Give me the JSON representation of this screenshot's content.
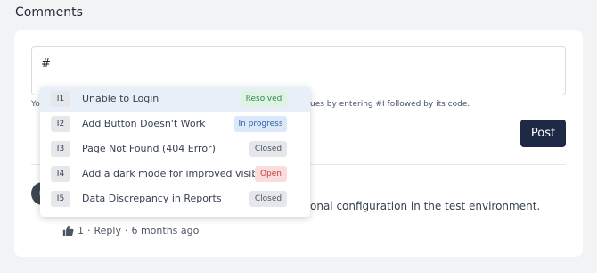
{
  "section_title": "Comments",
  "composer": {
    "value": "#",
    "hint_left": "Yo",
    "hint": "ues by entering #I followed by its code.",
    "post_label": "Post"
  },
  "comment": {
    "text_visible": "onal configuration in the test environment.",
    "likes": "1",
    "separator": "·",
    "reply_label": "Reply",
    "time": "6 months ago"
  },
  "dropdown": {
    "items": [
      {
        "code": "I1",
        "label": "Unable to Login",
        "status": "Resolved",
        "status_color": "#2f8a4f",
        "status_bg": "#dff3e4",
        "active": true
      },
      {
        "code": "I2",
        "label": "Add Button Doesn't Work",
        "status": "In progress",
        "status_color": "#2d5fa8",
        "status_bg": "#dbe8f8",
        "active": false
      },
      {
        "code": "I3",
        "label": "Page Not Found (404 Error)",
        "status": "Closed",
        "status_color": "#4b5563",
        "status_bg": "#e5e7eb",
        "active": false
      },
      {
        "code": "I4",
        "label": "Add a dark mode for improved visibility.",
        "status": "Open",
        "status_color": "#c2413b",
        "status_bg": "#fbdcdc",
        "active": false
      },
      {
        "code": "I5",
        "label": "Data Discrepancy in Reports",
        "status": "Closed",
        "status_color": "#4b5563",
        "status_bg": "#e5e7eb",
        "active": false
      }
    ]
  }
}
